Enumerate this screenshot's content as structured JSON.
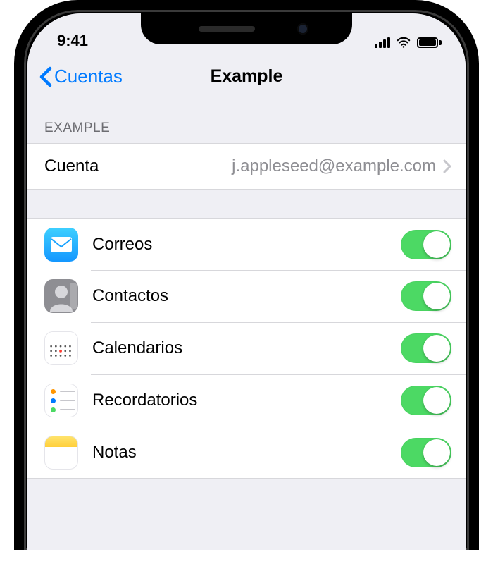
{
  "status": {
    "time": "9:41"
  },
  "nav": {
    "back_label": "Cuentas",
    "title": "Example"
  },
  "section": {
    "header": "EXAMPLE"
  },
  "account": {
    "label": "Cuenta",
    "value": "j.appleseed@example.com"
  },
  "services": [
    {
      "key": "mail",
      "label": "Correos",
      "icon": "mail-icon",
      "enabled": true
    },
    {
      "key": "contacts",
      "label": "Contactos",
      "icon": "contacts-icon",
      "enabled": true
    },
    {
      "key": "calendar",
      "label": "Calendarios",
      "icon": "calendar-icon",
      "enabled": true
    },
    {
      "key": "reminders",
      "label": "Recordatorios",
      "icon": "reminders-icon",
      "enabled": true
    },
    {
      "key": "notes",
      "label": "Notas",
      "icon": "notes-icon",
      "enabled": true
    }
  ],
  "colors": {
    "tint": "#007aff",
    "toggle_on": "#4cd964"
  }
}
